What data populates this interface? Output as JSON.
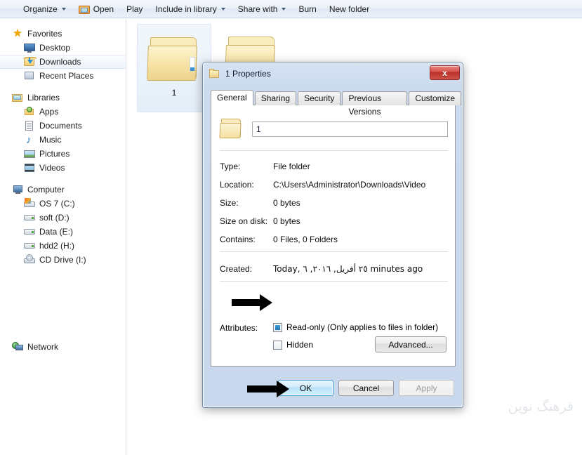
{
  "toolbar": {
    "items": [
      {
        "label": "Organize",
        "icon": "none",
        "caret": true
      },
      {
        "label": "Open",
        "icon": "open-folder-icon",
        "caret": false
      },
      {
        "label": "Play",
        "icon": "none",
        "caret": false
      },
      {
        "label": "Include in library",
        "icon": "none",
        "caret": true
      },
      {
        "label": "Share with",
        "icon": "none",
        "caret": true
      },
      {
        "label": "Burn",
        "icon": "none",
        "caret": false
      },
      {
        "label": "New folder",
        "icon": "none",
        "caret": false
      }
    ]
  },
  "navigation": {
    "groups": [
      {
        "label": "Favorites",
        "icon": "star-icon",
        "items": [
          {
            "label": "Desktop",
            "icon": "monitor-icon",
            "selected": false
          },
          {
            "label": "Downloads",
            "icon": "download-folder-icon",
            "selected": true
          },
          {
            "label": "Recent Places",
            "icon": "recent-places-icon",
            "selected": false
          }
        ]
      },
      {
        "label": "Libraries",
        "icon": "library-icon",
        "items": [
          {
            "label": "Apps",
            "icon": "apps-icon",
            "selected": false
          },
          {
            "label": "Documents",
            "icon": "document-icon",
            "selected": false
          },
          {
            "label": "Music",
            "icon": "music-note-icon",
            "selected": false
          },
          {
            "label": "Pictures",
            "icon": "picture-icon",
            "selected": false
          },
          {
            "label": "Videos",
            "icon": "video-icon",
            "selected": false
          }
        ]
      },
      {
        "label": "Computer",
        "icon": "computer-icon",
        "items": [
          {
            "label": "OS 7 (C:)",
            "icon": "system-drive-icon",
            "selected": false
          },
          {
            "label": "soft (D:)",
            "icon": "drive-icon",
            "selected": false
          },
          {
            "label": "Data (E:)",
            "icon": "drive-icon",
            "selected": false
          },
          {
            "label": "hdd2 (H:)",
            "icon": "drive-icon",
            "selected": false
          },
          {
            "label": "CD Drive (I:)",
            "icon": "cd-drive-icon",
            "selected": false
          }
        ]
      },
      {
        "label": "Network",
        "icon": "network-icon",
        "items": []
      }
    ]
  },
  "content": {
    "tiles": [
      {
        "label": "1",
        "selected": true
      },
      {
        "label": "",
        "selected": false
      }
    ]
  },
  "watermark": {
    "text": "فرهنگ نوین"
  },
  "dialog": {
    "title": "1 Properties",
    "close_label": "x",
    "tabs": [
      {
        "label": "General",
        "active": true
      },
      {
        "label": "Sharing",
        "active": false
      },
      {
        "label": "Security",
        "active": false
      },
      {
        "label": "Previous Versions",
        "active": false
      },
      {
        "label": "Customize",
        "active": false
      }
    ],
    "name_value": "1",
    "properties": [
      {
        "label": "Type:",
        "value": "File folder"
      },
      {
        "label": "Location:",
        "value": "C:\\Users\\Administrator\\Downloads\\Video"
      },
      {
        "label": "Size:",
        "value": "0 bytes"
      },
      {
        "label": "Size on disk:",
        "value": "0 bytes"
      },
      {
        "label": "Contains:",
        "value": "0 Files, 0 Folders"
      }
    ],
    "created": {
      "label": "Created:",
      "value": "Today, ٢٥ أفريل, ٢٠١٦, ٦ minutes ago"
    },
    "attributes": {
      "label": "Attributes:",
      "readonly": {
        "label": "Read-only (Only applies to files in folder)",
        "state": "indeterminate"
      },
      "hidden": {
        "label": "Hidden",
        "state": "unchecked"
      },
      "advanced_label": "Advanced..."
    },
    "buttons": {
      "ok": "OK",
      "cancel": "Cancel",
      "apply": "Apply"
    }
  },
  "colors": {
    "accent": "#3c9fd4",
    "title_bar": "#cbdaee",
    "close_button": "#c03a31",
    "checkbox_fill": "#1b74b4"
  }
}
